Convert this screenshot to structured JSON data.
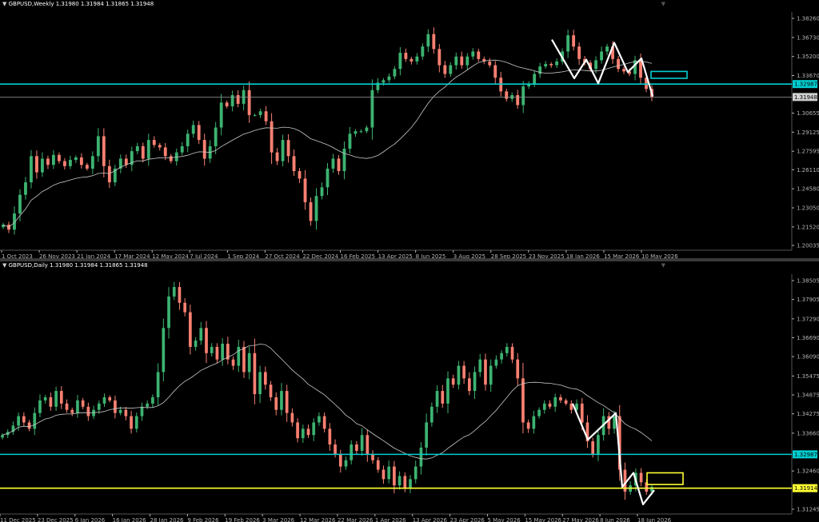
{
  "colors": {
    "background": "#000000",
    "bull": "#3cb371",
    "bear": "#fa8072",
    "ma": "#c8c8c8",
    "cyan": "#00ced1",
    "yellow": "#ffff33",
    "axis": "#b4b4b4",
    "white": "#ffffff"
  },
  "panels": [
    {
      "id": "weekly",
      "title": "GBPUSD,Weekly  1.31980 1.31984 1.31865 1.31948",
      "y_ticks": [
        "1.38260",
        "1.36730",
        "1.35200",
        "1.33670",
        "1.32987",
        "1.31948",
        "1.30655",
        "1.29125",
        "1.27595",
        "1.26110",
        "1.24580",
        "1.23050",
        "1.21520",
        "1.20035"
      ],
      "x_ticks": [
        "1 Oct 2023",
        "26 Nov 2023",
        "21 Jan 2024",
        "17 Mar 2024",
        "12 May 2024",
        "7 Jul 2024",
        "1 Sep 2024",
        "27 Oct 2024",
        "22 Dec 2024",
        "16 Feb 2025",
        "13 Apr 2025",
        "8 Jun 2025",
        "3 Aug 2025",
        "28 Sep 2025",
        "23 Nov 2025",
        "18 Jan 2026",
        "15 Mar 2026",
        "10 May 2026"
      ],
      "levels": [
        {
          "price": 1.32987,
          "label": "1.32987",
          "color": "#00ced1"
        },
        {
          "price": 1.31948,
          "label": "1.31948",
          "color": "#9a9a9a"
        }
      ]
    },
    {
      "id": "daily",
      "title": "GBPUSD,Daily  1.31980 1.31984 1.31865 1.31948",
      "y_ticks": [
        "1.38505",
        "1.37905",
        "1.37290",
        "1.36690",
        "1.36090",
        "1.35475",
        "1.34875",
        "1.34275",
        "1.33660",
        "1.32987",
        "1.32460",
        "1.31914",
        "1.31245"
      ],
      "x_ticks": [
        "11 Dec 2025",
        "23 Dec 2025",
        "6 Jan 2026",
        "16 Jan 2026",
        "28 Jan 2026",
        "9 Feb 2026",
        "19 Feb 2026",
        "3 Mar 2026",
        "12 Mar 2026",
        "22 Mar 2026",
        "1 Apr 2026",
        "13 Apr 2026",
        "23 Apr 2026",
        "5 May 2026",
        "15 May 2026",
        "27 May 2026",
        "8 Jun 2026",
        "18 Jun 2026"
      ],
      "levels": [
        {
          "price": 1.32987,
          "label": "1.32987",
          "color": "#00ced1"
        },
        {
          "price": 1.31914,
          "label": "1.31914",
          "color": "#ffff33"
        }
      ]
    }
  ],
  "chart_data": [
    {
      "type": "candlestick",
      "symbol": "GBPUSD",
      "timeframe": "Weekly",
      "ohlc_last": {
        "open": 1.3198,
        "high": 1.31984,
        "low": 1.31865,
        "close": 1.31948
      },
      "ylim": [
        1.20035,
        1.3826
      ],
      "x_ticks": [
        "1 Oct 2023",
        "26 Nov 2023",
        "21 Jan 2024",
        "17 Mar 2024",
        "12 May 2024",
        "7 Jul 2024",
        "1 Sep 2024",
        "27 Oct 2024",
        "22 Dec 2024",
        "16 Feb 2025",
        "13 Apr 2025",
        "8 Jun 2025",
        "3 Aug 2025",
        "28 Sep 2025",
        "23 Nov 2025",
        "18 Jan 2026",
        "15 Mar 2026",
        "10 May 2026"
      ],
      "close_path": [
        1.217,
        1.213,
        1.226,
        1.241,
        1.251,
        1.272,
        1.259,
        1.27,
        1.265,
        1.273,
        1.268,
        1.264,
        1.269,
        1.271,
        1.265,
        1.262,
        1.272,
        1.288,
        1.264,
        1.251,
        1.262,
        1.27,
        1.265,
        1.276,
        1.28,
        1.27,
        1.285,
        1.281,
        1.279,
        1.272,
        1.268,
        1.275,
        1.28,
        1.29,
        1.297,
        1.285,
        1.27,
        1.28,
        1.295,
        1.315,
        1.312,
        1.321,
        1.314,
        1.325,
        1.305,
        1.305,
        1.308,
        1.3,
        1.275,
        1.268,
        1.285,
        1.272,
        1.26,
        1.254,
        1.235,
        1.22,
        1.24,
        1.247,
        1.262,
        1.27,
        1.26,
        1.278,
        1.29,
        1.292,
        1.292,
        1.295,
        1.325,
        1.331,
        1.333,
        1.336,
        1.342,
        1.355,
        1.35,
        1.348,
        1.352,
        1.36,
        1.37,
        1.358,
        1.345,
        1.338,
        1.345,
        1.352,
        1.345,
        1.352,
        1.356,
        1.35,
        1.348,
        1.345,
        1.335,
        1.324,
        1.318,
        1.321,
        1.313,
        1.328,
        1.33,
        1.338,
        1.344,
        1.346,
        1.345,
        1.348,
        1.356,
        1.369,
        1.36,
        1.35,
        1.347,
        1.342,
        1.349,
        1.356,
        1.36,
        1.35,
        1.342,
        1.34,
        1.338,
        1.349,
        1.335,
        1.326,
        1.3195
      ],
      "moving_average": true,
      "horizontal_levels": [
        1.32987,
        1.31948
      ]
    },
    {
      "type": "candlestick",
      "symbol": "GBPUSD",
      "timeframe": "Daily",
      "ohlc_last": {
        "open": 1.3198,
        "high": 1.31984,
        "low": 1.31865,
        "close": 1.31948
      },
      "ylim": [
        1.31245,
        1.38505
      ],
      "x_ticks": [
        "11 Dec 2025",
        "23 Dec 2025",
        "6 Jan 2026",
        "16 Jan 2026",
        "28 Jan 2026",
        "9 Feb 2026",
        "19 Feb 2026",
        "3 Mar 2026",
        "12 Mar 2026",
        "22 Mar 2026",
        "1 Apr 2026",
        "13 Apr 2026",
        "23 Apr 2026",
        "5 May 2026",
        "15 May 2026",
        "27 May 2026",
        "8 Jun 2026",
        "18 Jun 2026"
      ],
      "close_path": [
        1.336,
        1.337,
        1.339,
        1.342,
        1.34,
        1.338,
        1.343,
        1.347,
        1.348,
        1.345,
        1.35,
        1.346,
        1.344,
        1.343,
        1.347,
        1.345,
        1.342,
        1.344,
        1.346,
        1.348,
        1.347,
        1.343,
        1.344,
        1.342,
        1.338,
        1.342,
        1.345,
        1.346,
        1.348,
        1.356,
        1.37,
        1.38,
        1.383,
        1.378,
        1.375,
        1.364,
        1.366,
        1.37,
        1.362,
        1.364,
        1.36,
        1.365,
        1.36,
        1.358,
        1.364,
        1.356,
        1.362,
        1.349,
        1.356,
        1.352,
        1.348,
        1.344,
        1.35,
        1.343,
        1.34,
        1.335,
        1.338,
        1.336,
        1.34,
        1.342,
        1.338,
        1.333,
        1.33,
        1.326,
        1.328,
        1.333,
        1.331,
        1.336,
        1.33,
        1.328,
        1.325,
        1.322,
        1.326,
        1.32,
        1.323,
        1.319,
        1.322,
        1.326,
        1.332,
        1.34,
        1.345,
        1.35,
        1.346,
        1.354,
        1.352,
        1.358,
        1.354,
        1.35,
        1.356,
        1.36,
        1.352,
        1.358,
        1.36,
        1.362,
        1.364,
        1.36,
        1.354,
        1.34,
        1.338,
        1.342,
        1.344,
        1.346,
        1.345,
        1.348,
        1.347,
        1.346,
        1.344,
        1.346,
        1.34,
        1.334,
        1.33,
        1.336,
        1.342,
        1.338,
        1.342,
        1.325,
        1.318,
        1.32,
        1.324,
        1.321,
        1.318,
        1.3195
      ],
      "moving_average": true,
      "horizontal_levels": [
        1.32987,
        1.31914
      ]
    }
  ]
}
